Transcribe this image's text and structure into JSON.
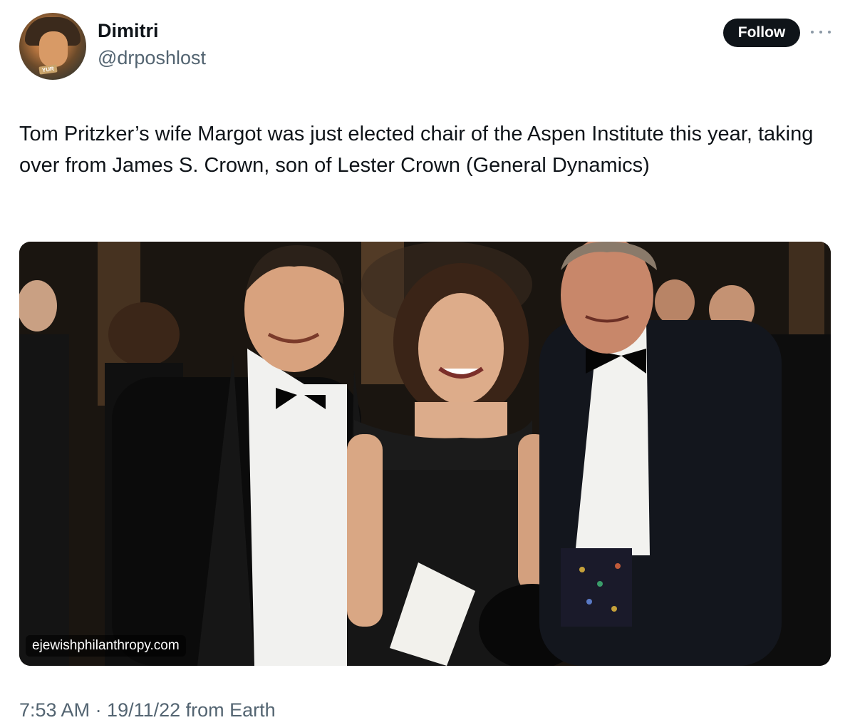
{
  "author": {
    "display_name": "Dimitri",
    "handle": "@drposhlost",
    "avatar_badge": "YUR"
  },
  "actions": {
    "follow_label": "Follow",
    "more_icon": "more-horizontal-icon"
  },
  "tweet": {
    "text": "Tom Pritzker’s wife Margot was just elected chair of the Aspen Institute this year, taking over from James S. Crown, son of Lester Crown (General Dynamics)"
  },
  "media": {
    "watermark": "ejewishphilanthropy.com"
  },
  "footer": {
    "timestamp": "7:53 AM · 19/11/22 from Earth"
  },
  "colors": {
    "text_primary": "#0f1419",
    "text_secondary": "#536471",
    "follow_bg": "#0f1419",
    "follow_text": "#ffffff"
  }
}
